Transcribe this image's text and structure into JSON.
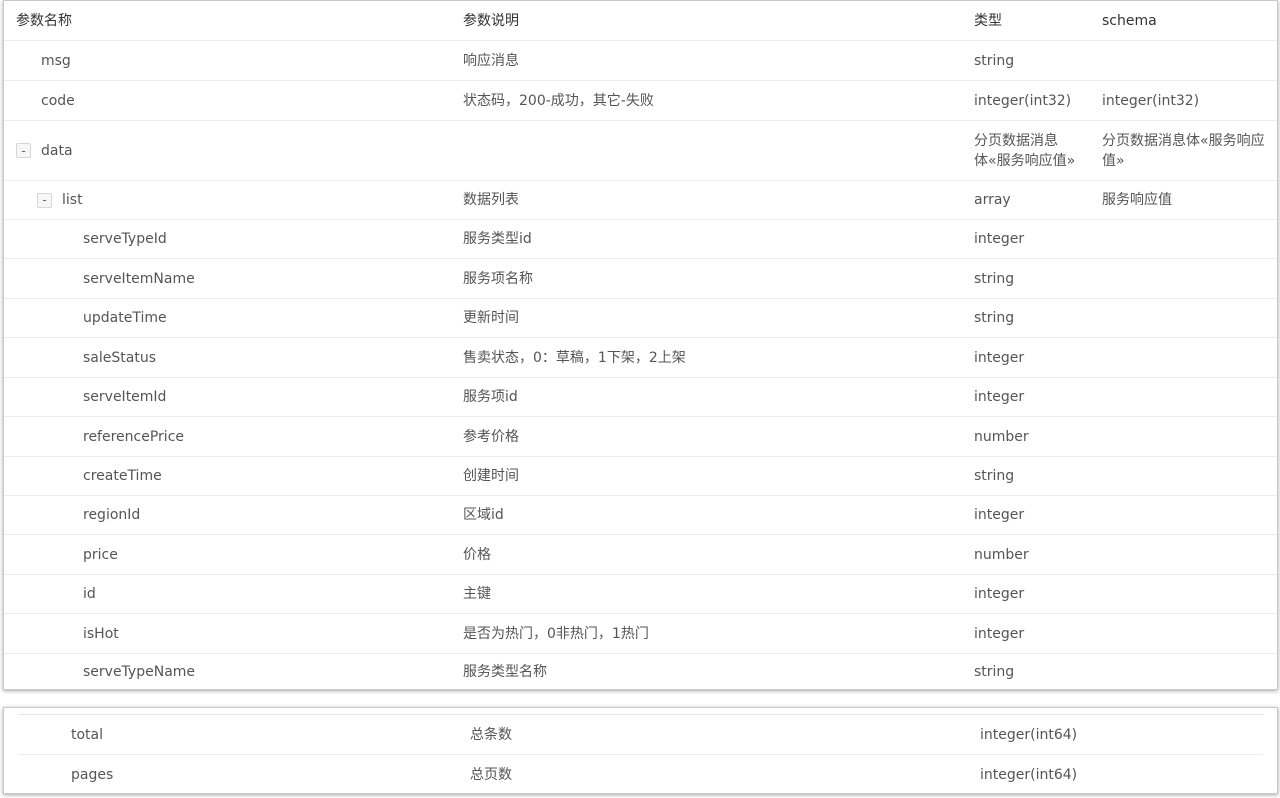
{
  "header": {
    "col_name": "参数名称",
    "col_desc": "参数说明",
    "col_type": "类型",
    "col_schema": "schema"
  },
  "rows": [
    {
      "name": "msg",
      "desc": "响应消息",
      "type": "string",
      "schema": ""
    },
    {
      "name": "code",
      "desc": "状态码，200-成功，其它-失败",
      "type": "integer(int32)",
      "schema": "integer(int32)"
    },
    {
      "name": "data",
      "desc": "",
      "type": "分页数据消息体«服务响应值»",
      "schema": "分页数据消息体«服务响应值»",
      "toggle": "-"
    },
    {
      "name": "list",
      "desc": "数据列表",
      "type": "array",
      "schema": "服务响应值",
      "toggle": "-"
    },
    {
      "name": "serveTypeId",
      "desc": "服务类型id",
      "type": "integer",
      "schema": ""
    },
    {
      "name": "serveItemName",
      "desc": "服务项名称",
      "type": "string",
      "schema": ""
    },
    {
      "name": "updateTime",
      "desc": "更新时间",
      "type": "string",
      "schema": ""
    },
    {
      "name": "saleStatus",
      "desc": "售卖状态，0：草稿，1下架，2上架",
      "type": "integer",
      "schema": ""
    },
    {
      "name": "serveItemId",
      "desc": "服务项id",
      "type": "integer",
      "schema": ""
    },
    {
      "name": "referencePrice",
      "desc": "参考价格",
      "type": "number",
      "schema": ""
    },
    {
      "name": "createTime",
      "desc": "创建时间",
      "type": "string",
      "schema": ""
    },
    {
      "name": "regionId",
      "desc": "区域id",
      "type": "integer",
      "schema": ""
    },
    {
      "name": "price",
      "desc": "价格",
      "type": "number",
      "schema": ""
    },
    {
      "name": "id",
      "desc": "主键",
      "type": "integer",
      "schema": ""
    },
    {
      "name": "isHot",
      "desc": "是否为热门，0非热门，1热门",
      "type": "integer",
      "schema": ""
    },
    {
      "name": "serveTypeName",
      "desc": "服务类型名称",
      "type": "string",
      "schema": ""
    }
  ],
  "footer_rows": [
    {
      "name": "total",
      "desc": "总条数",
      "type": "integer(int64)",
      "schema": ""
    },
    {
      "name": "pages",
      "desc": "总页数",
      "type": "integer(int64)",
      "schema": ""
    }
  ]
}
